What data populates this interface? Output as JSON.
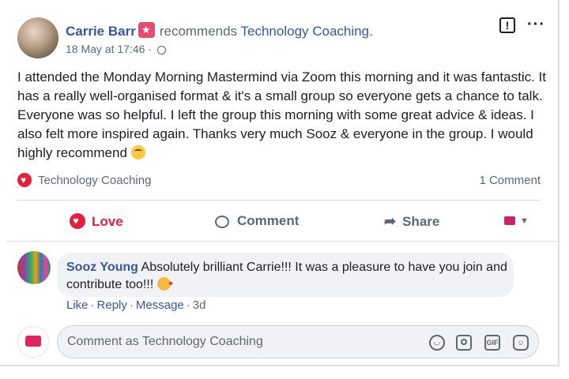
{
  "post": {
    "author": "Carrie Barr",
    "action": "recommends",
    "page": "Technology Coaching.",
    "timestamp": "18 May at 17:46 ·",
    "body": "I attended the Monday Morning Mastermind via Zoom this morning and it was fantastic. It has a really well-organised format & it's a small group so everyone gets a chance to talk. Everyone was so helpful. I left the group this morning with some great advice & ideas. I also felt more inspired again. Thanks very much Sooz & everyone in the group. I would highly recommend"
  },
  "stats": {
    "page_name": "Technology Coaching",
    "comments": "1 Comment"
  },
  "actions": {
    "love": "Love",
    "comment": "Comment",
    "share": "Share"
  },
  "comment": {
    "author": "Sooz Young",
    "text": "Absolutely brilliant Carrie!!! It was a pleasure to have you join and contribute too!!!",
    "like": "Like",
    "reply": "Reply",
    "message": "Message",
    "time": "3d"
  },
  "composer": {
    "placeholder": "Comment as Technology Coaching"
  },
  "colors": {
    "link": "#385898",
    "love": "#e41e3f",
    "muted": "#606770"
  },
  "icons": [
    "report-icon",
    "more-icon",
    "globe-icon",
    "love-icon",
    "comment-icon",
    "share-icon",
    "audience-flag-icon",
    "emoji-icon",
    "camera-icon",
    "gif-icon",
    "sticker-icon"
  ]
}
